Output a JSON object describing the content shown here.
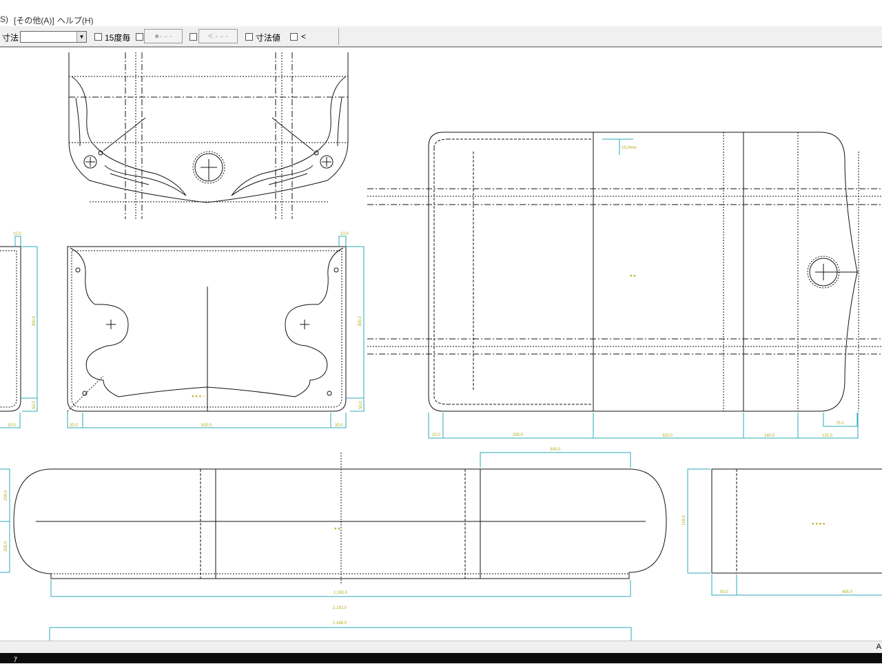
{
  "menu": {
    "item0": "S)",
    "item1": "[その他(A)]",
    "item2": "ヘルプ(H)"
  },
  "toolbar": {
    "dimension_label": "寸法",
    "dimension_select_value": "",
    "every15_label": "15度毎",
    "dot_line_button": "●- - -",
    "arrow_line_button": "< - - -",
    "dimension_value_label": "寸法値",
    "arrow_label": "<"
  },
  "drawing": {
    "dims": {
      "d_15_0_mid": "15.0mm",
      "d_10_0_l": "10.0",
      "d_10_0_r": "10.0",
      "d_300_0_l": "300.0",
      "d_300_0_r": "300.0",
      "d_50_0_l": "50.0",
      "d_50_0_r": "50.0",
      "d_20_0_a": "20.0",
      "d_20_0_b": "20.0",
      "d_20_0_c": "20.0",
      "d_500_0": "500.0",
      "d_30_0_r": "30.0",
      "d_205_0": "205.0",
      "d_333_0": "333.0",
      "d_140_0": "140.0",
      "d_120_0": "120.0",
      "d_75_0": "75.0",
      "d_300_0_top": "300.0",
      "d_1182_0": "1,182.0",
      "d_2182_0": "2,182.0",
      "d_1188_0": "1,188.0",
      "d_205_0_v1": "205.0",
      "d_205_0_v2": "205.0",
      "d_118_0": "118.0",
      "d_50_0_bot": "50.0",
      "d_455_0": "455.0"
    },
    "labels": {
      "flap": "● ● ● ○",
      "body": "● ●",
      "strip": "● ●",
      "side": "● ● ● ●"
    }
  },
  "status": {
    "right_text": "A"
  },
  "taskbar": {
    "ime": "ｱ"
  },
  "colors": {
    "dimension": "#29a9b9",
    "dimension_text": "#b4a91c",
    "outline": "#111111"
  }
}
